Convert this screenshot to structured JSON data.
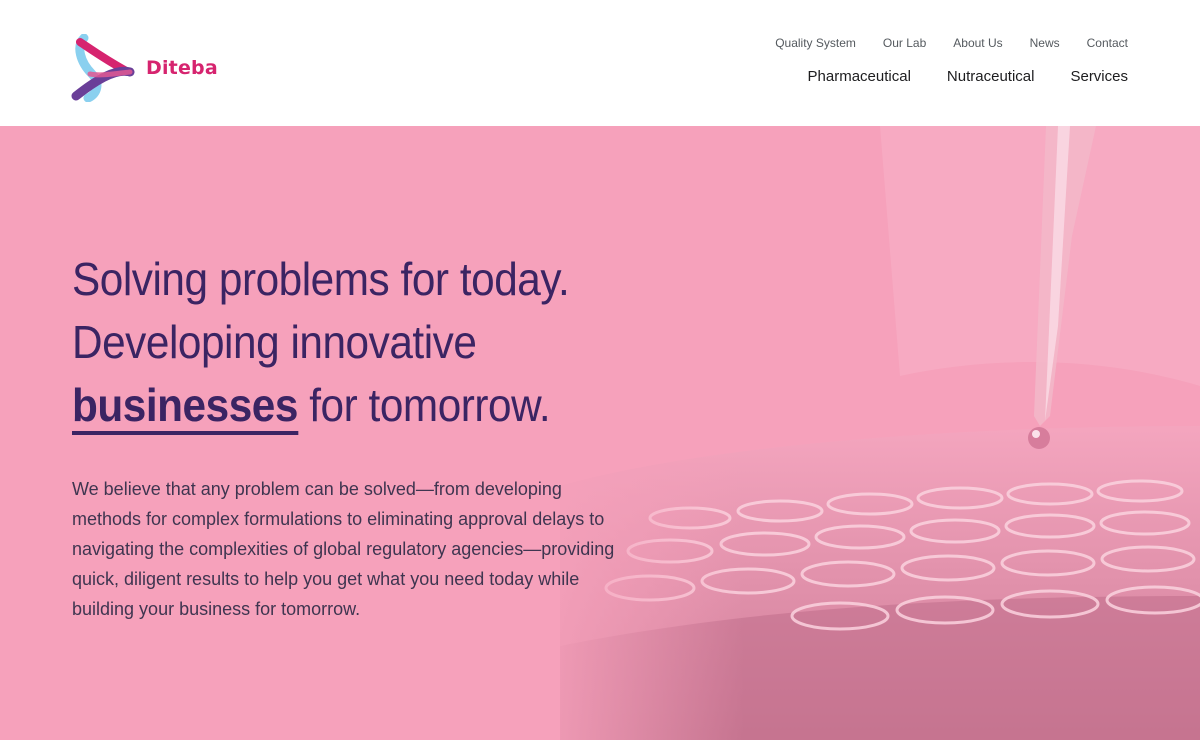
{
  "brand": {
    "name": "Diteba"
  },
  "utility_nav": [
    {
      "label": "Quality System"
    },
    {
      "label": "Our Lab"
    },
    {
      "label": "About Us"
    },
    {
      "label": "News"
    },
    {
      "label": "Contact"
    }
  ],
  "main_nav": [
    {
      "label": "Pharmaceutical"
    },
    {
      "label": "Nutraceutical"
    },
    {
      "label": "Services"
    }
  ],
  "hero": {
    "headline_line1": "Solving problems for today.",
    "headline_line2": "Developing innovative",
    "headline_strong": "businesses",
    "headline_line3_rest": " for tomorrow.",
    "body": "We believe that any problem can be solved—from developing methods for complex formulations to eliminating approval delays to navigating the complexities of global regulatory agencies—providing quick, diligent results to help you get what you need today while building your business for tomorrow.",
    "image_icon": "pipette-wellplate-photo"
  },
  "colors": {
    "brand_pink": "#d6246f",
    "hero_bg": "#f6a1bb",
    "headline": "#3b2463",
    "body_text": "#3f3550"
  }
}
